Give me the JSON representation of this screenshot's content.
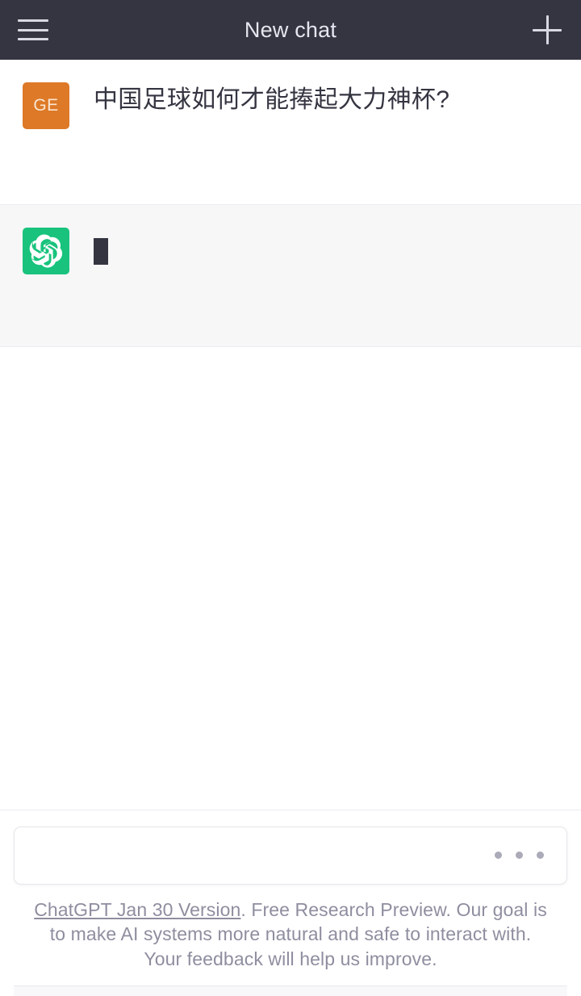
{
  "header": {
    "title": "New chat",
    "menu_icon": "hamburger-icon",
    "new_chat_icon": "plus-icon"
  },
  "conversation": {
    "messages": [
      {
        "role": "user",
        "avatar_initials": "GE",
        "avatar_color": "#dd7927",
        "text": "中国足球如何才能捧起大力神杯?"
      },
      {
        "role": "assistant",
        "avatar_icon": "openai-logo-icon",
        "avatar_color": "#19c37d",
        "text": "",
        "status": "typing"
      }
    ]
  },
  "composer": {
    "value": "",
    "placeholder": "",
    "loading_icon": "three-dots-icon"
  },
  "footer": {
    "link_text": "ChatGPT Jan 30 Version",
    "disclaimer": ". Free Research Preview. Our goal is to make AI systems more natural and safe to interact with. Your feedback will help us improve."
  }
}
